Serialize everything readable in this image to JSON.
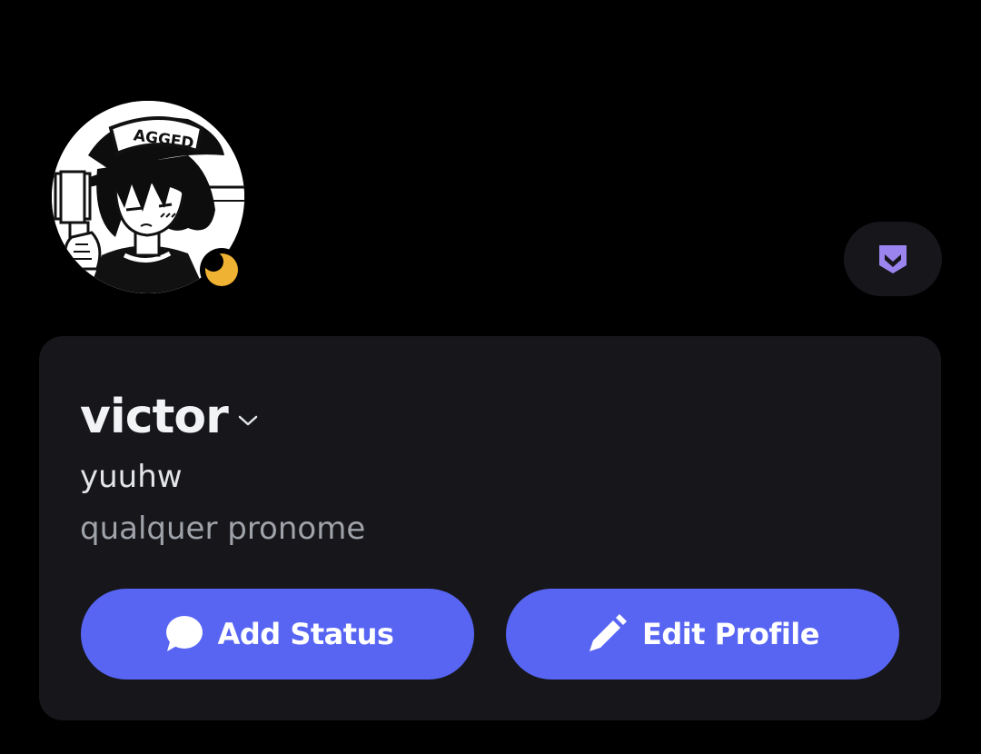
{
  "profile": {
    "display_name": "victor",
    "username": "yuuhw",
    "pronouns": "qualquer pronome",
    "status": "idle",
    "avatar_cap_text": "AGGED"
  },
  "actions": {
    "add_status_label": "Add Status",
    "edit_profile_label": "Edit Profile"
  },
  "icons": {
    "badge": "nitro-chevron-icon",
    "status": "moon-idle-icon",
    "add_status": "speech-bubble-icon",
    "edit_profile": "pencil-icon",
    "name_dropdown": "chevron-down-icon"
  },
  "colors": {
    "background": "#000000",
    "card": "#16161b",
    "accent": "#5865f2",
    "idle": "#f0b232",
    "badge": "#9b84ee"
  }
}
